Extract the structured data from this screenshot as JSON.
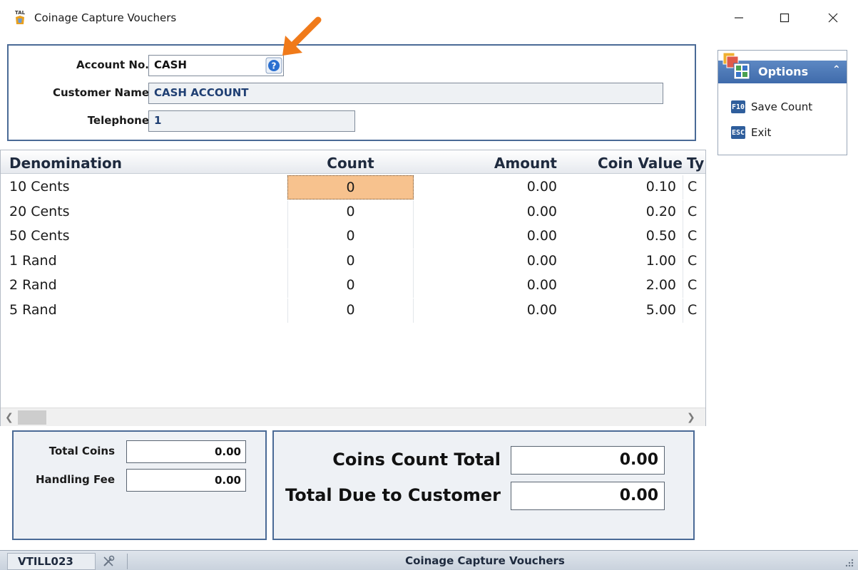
{
  "window": {
    "title": "Coinage Capture Vouchers",
    "app_icon": "tal-logo-icon",
    "icon_text": "TAL"
  },
  "header": {
    "account_label": "Account No.",
    "account_value": "CASH",
    "customer_label": "Customer Name",
    "customer_value": "CASH ACCOUNT",
    "telephone_label": "Telephone",
    "telephone_value": "1"
  },
  "grid": {
    "columns": [
      "Denomination",
      "Count",
      "Amount",
      "Coin Value",
      "Ty"
    ],
    "rows": [
      {
        "denomination": "10 Cents",
        "count": "0",
        "amount": "0.00",
        "coin_value": "0.10",
        "type": "C"
      },
      {
        "denomination": "20 Cents",
        "count": "0",
        "amount": "0.00",
        "coin_value": "0.20",
        "type": "C"
      },
      {
        "denomination": "50 Cents",
        "count": "0",
        "amount": "0.00",
        "coin_value": "0.50",
        "type": "C"
      },
      {
        "denomination": "1 Rand",
        "count": "0",
        "amount": "0.00",
        "coin_value": "1.00",
        "type": "C"
      },
      {
        "denomination": "2 Rand",
        "count": "0",
        "amount": "0.00",
        "coin_value": "2.00",
        "type": "C"
      },
      {
        "denomination": "5 Rand",
        "count": "0",
        "amount": "0.00",
        "coin_value": "5.00",
        "type": "C"
      }
    ],
    "active_cell_color": "#f7c28e"
  },
  "totals_left": {
    "total_coins_label": "Total Coins",
    "total_coins_value": "0.00",
    "handling_fee_label": "Handling Fee",
    "handling_fee_value": "0.00"
  },
  "totals_right": {
    "coins_count_total_label": "Coins Count Total",
    "coins_count_total_value": "0.00",
    "total_due_label": "Total Due to Customer",
    "total_due_value": "0.00"
  },
  "options": {
    "title": "Options",
    "items": [
      {
        "key": "F10",
        "label": "Save Count"
      },
      {
        "key": "ESC",
        "label": "Exit"
      }
    ]
  },
  "statusbar": {
    "terminal": "VTILL023",
    "center_text": "Coinage Capture Vouchers"
  },
  "colors": {
    "panel_border": "#4a6a96",
    "options_header": "#4a77b5",
    "annotation_arrow": "#f07a1a"
  }
}
